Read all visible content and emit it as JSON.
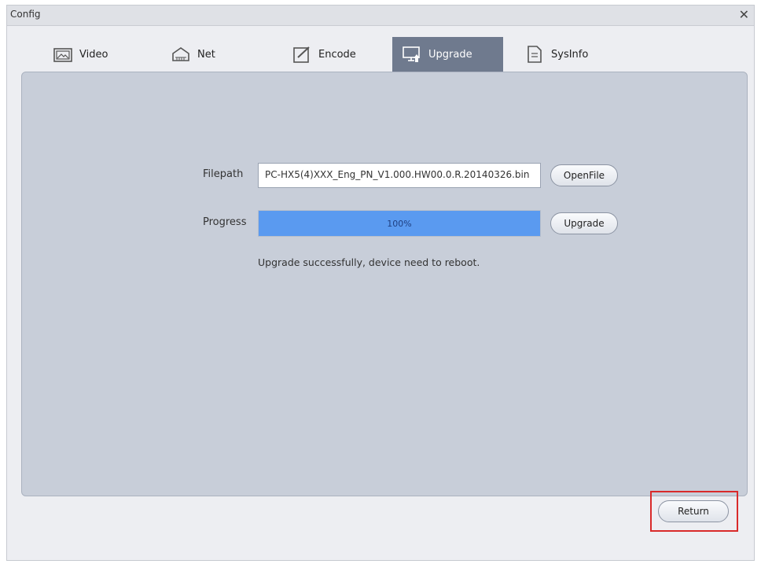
{
  "window": {
    "title": "Config"
  },
  "tabs": [
    {
      "label": "Video",
      "icon": "image-icon"
    },
    {
      "label": "Net",
      "icon": "network-icon"
    },
    {
      "label": "Encode",
      "icon": "edit-icon"
    },
    {
      "label": "Upgrade",
      "icon": "monitor-upgrade-icon",
      "active": true
    },
    {
      "label": "SysInfo",
      "icon": "document-icon"
    }
  ],
  "upgrade": {
    "filepath_label": "Filepath",
    "filepath_value": "PC-HX5(4)XXX_Eng_PN_V1.000.HW00.0.R.20140326.bin",
    "openfile_label": "OpenFile",
    "progress_label": "Progress",
    "progress_value": 1.0,
    "progress_text": "100%",
    "upgrade_button": "Upgrade",
    "status_text": "Upgrade successfully, device need to reboot."
  },
  "footer": {
    "return_label": "Return"
  },
  "colors": {
    "accent_tab": "#6f7a8e",
    "progress_fill": "#5a9af0",
    "highlight_box": "#d92a2a"
  }
}
